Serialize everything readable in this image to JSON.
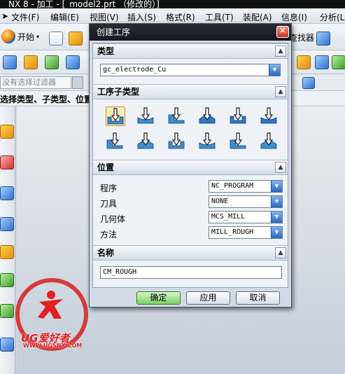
{
  "app": {
    "title": "NX 8 - 加工 - [_model2.prt （修改的）]",
    "menu": [
      "文件(F)",
      "编辑(E)",
      "视图(V)",
      "插入(S)",
      "格式(R)",
      "工具(T)",
      "装配(A)",
      "信息(I)",
      "分析(L)"
    ],
    "start_label": "开始",
    "finder_label": "查找器",
    "filter_placeholder": "没有选择过滤器",
    "cue_text": "选择类型、子类型、位置"
  },
  "dialog": {
    "title": "创建工序",
    "close_glyph": "✕",
    "type_section": {
      "label": "类型",
      "value": "gc_electrode_Cu"
    },
    "subtype_section": {
      "label": "工序子类型",
      "row1": [
        "cavity-mill-icon",
        "plunge-mill-icon",
        "corner-rough-icon",
        "rest-mill-icon",
        "zlevel-profile-icon",
        "zlevel-corner-icon"
      ],
      "row2": [
        "fixed-contour-icon",
        "contour-area-icon",
        "contour-surface-icon",
        "streamline-icon",
        "flowcut-single-icon",
        "flowcut-multiple-icon"
      ],
      "selected_index": 0
    },
    "location_section": {
      "label": "位置",
      "fields": [
        {
          "label": "程序",
          "value": "NC_PROGRAM"
        },
        {
          "label": "刀具",
          "value": "NONE"
        },
        {
          "label": "几何体",
          "value": "MCS_MILL"
        },
        {
          "label": "方法",
          "value": "MILL_ROUGH"
        }
      ]
    },
    "name_section": {
      "label": "名称",
      "value": "CM_ROUGH"
    },
    "buttons": {
      "ok": "确定",
      "apply": "应用",
      "cancel": "取消"
    }
  },
  "watermark": {
    "brand": "UG爱好者",
    "url": "WWW.UGSNX.COM"
  },
  "colors": {
    "dialog_title_bg": "#14171c",
    "section_bg": "#d4dce7",
    "ok_button": "#7fcf68",
    "dropdown_arrow": "#2b68c4",
    "watermark_red": "#e21f1f"
  }
}
